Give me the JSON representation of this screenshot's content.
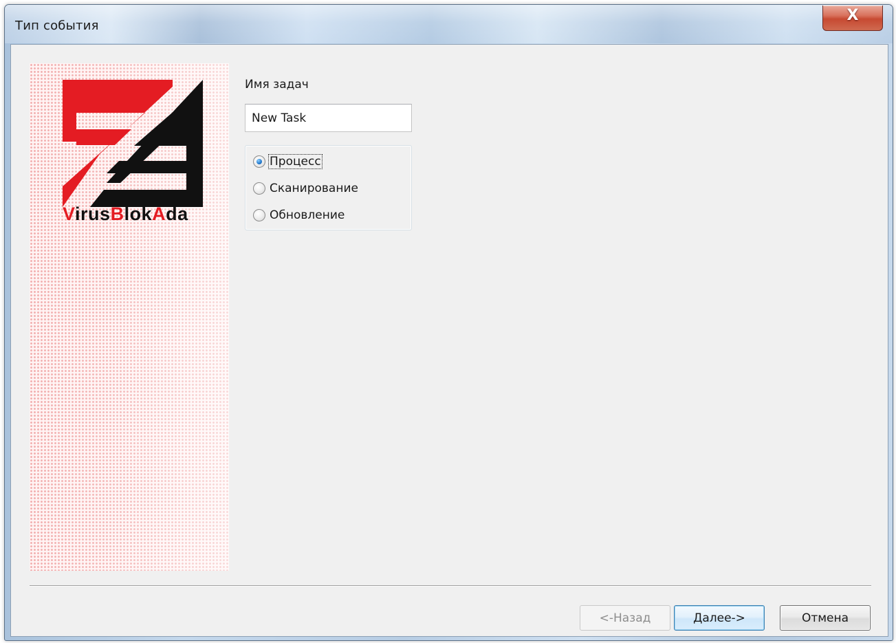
{
  "window": {
    "title": "Тип события",
    "close_glyph": "X"
  },
  "logo": {
    "icon": "virusblokada-logo",
    "brand_text": "VirusBlokAda",
    "brand_parts": [
      "V",
      "irus",
      "B",
      "lok",
      "A",
      "da"
    ],
    "colors": {
      "red": "#e41c23",
      "black": "#111111"
    }
  },
  "form": {
    "name_label": "Имя задач",
    "name_value": "New Task",
    "event_types": [
      {
        "label": "Процесс",
        "checked": true,
        "focused": true
      },
      {
        "label": "Сканирование",
        "checked": false,
        "focused": false
      },
      {
        "label": "Обновление",
        "checked": false,
        "focused": false
      }
    ]
  },
  "buttons": {
    "back": {
      "label": "<-Назад",
      "enabled": false
    },
    "next": {
      "label": "Далее->",
      "enabled": true,
      "default": true
    },
    "cancel": {
      "label": "Отмена",
      "enabled": true
    }
  }
}
